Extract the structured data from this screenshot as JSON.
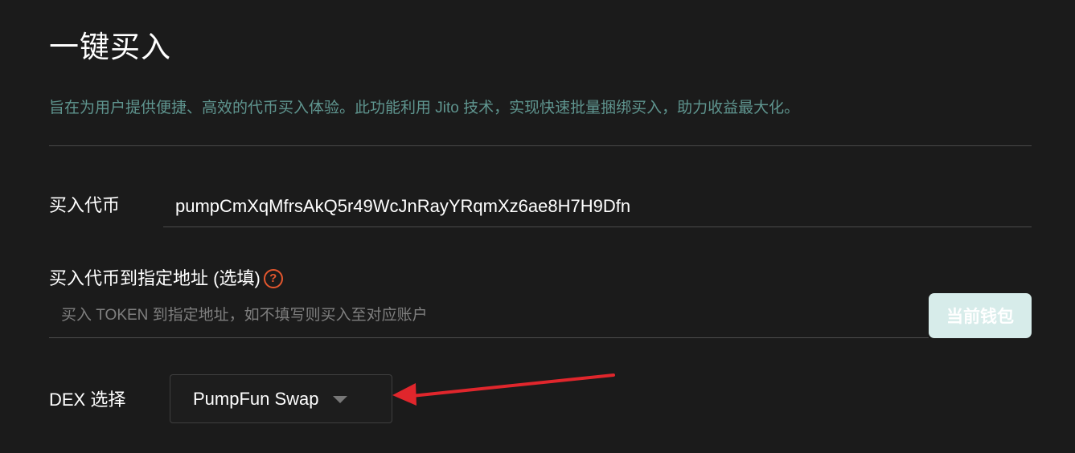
{
  "header": {
    "title": "一键买入",
    "description": "旨在为用户提供便捷、高效的代币买入体验。此功能利用 Jito 技术，实现快速批量捆绑买入，助力收益最大化。"
  },
  "form": {
    "token": {
      "label": "买入代币",
      "value": "pumpCmXqMfrsAkQ5r49WcJnRayYRqmXz6ae8H7H9Dfn"
    },
    "destination": {
      "label": "买入代币到指定地址 (选填)",
      "help_icon": "question-circle-icon",
      "help_symbol": "?",
      "placeholder": "买入 TOKEN 到指定地址，如不填写则买入至对应账户",
      "value": "",
      "current_wallet_button": "当前钱包"
    },
    "dex": {
      "label": "DEX 选择",
      "selected": "PumpFun Swap",
      "icon": "chevron-down-icon"
    }
  },
  "colors": {
    "background": "#1b1b1b",
    "description": "#5f958f",
    "help_icon": "#e4572e",
    "wallet_button": "#d7ecea",
    "annotation_arrow": "#e0262c"
  }
}
